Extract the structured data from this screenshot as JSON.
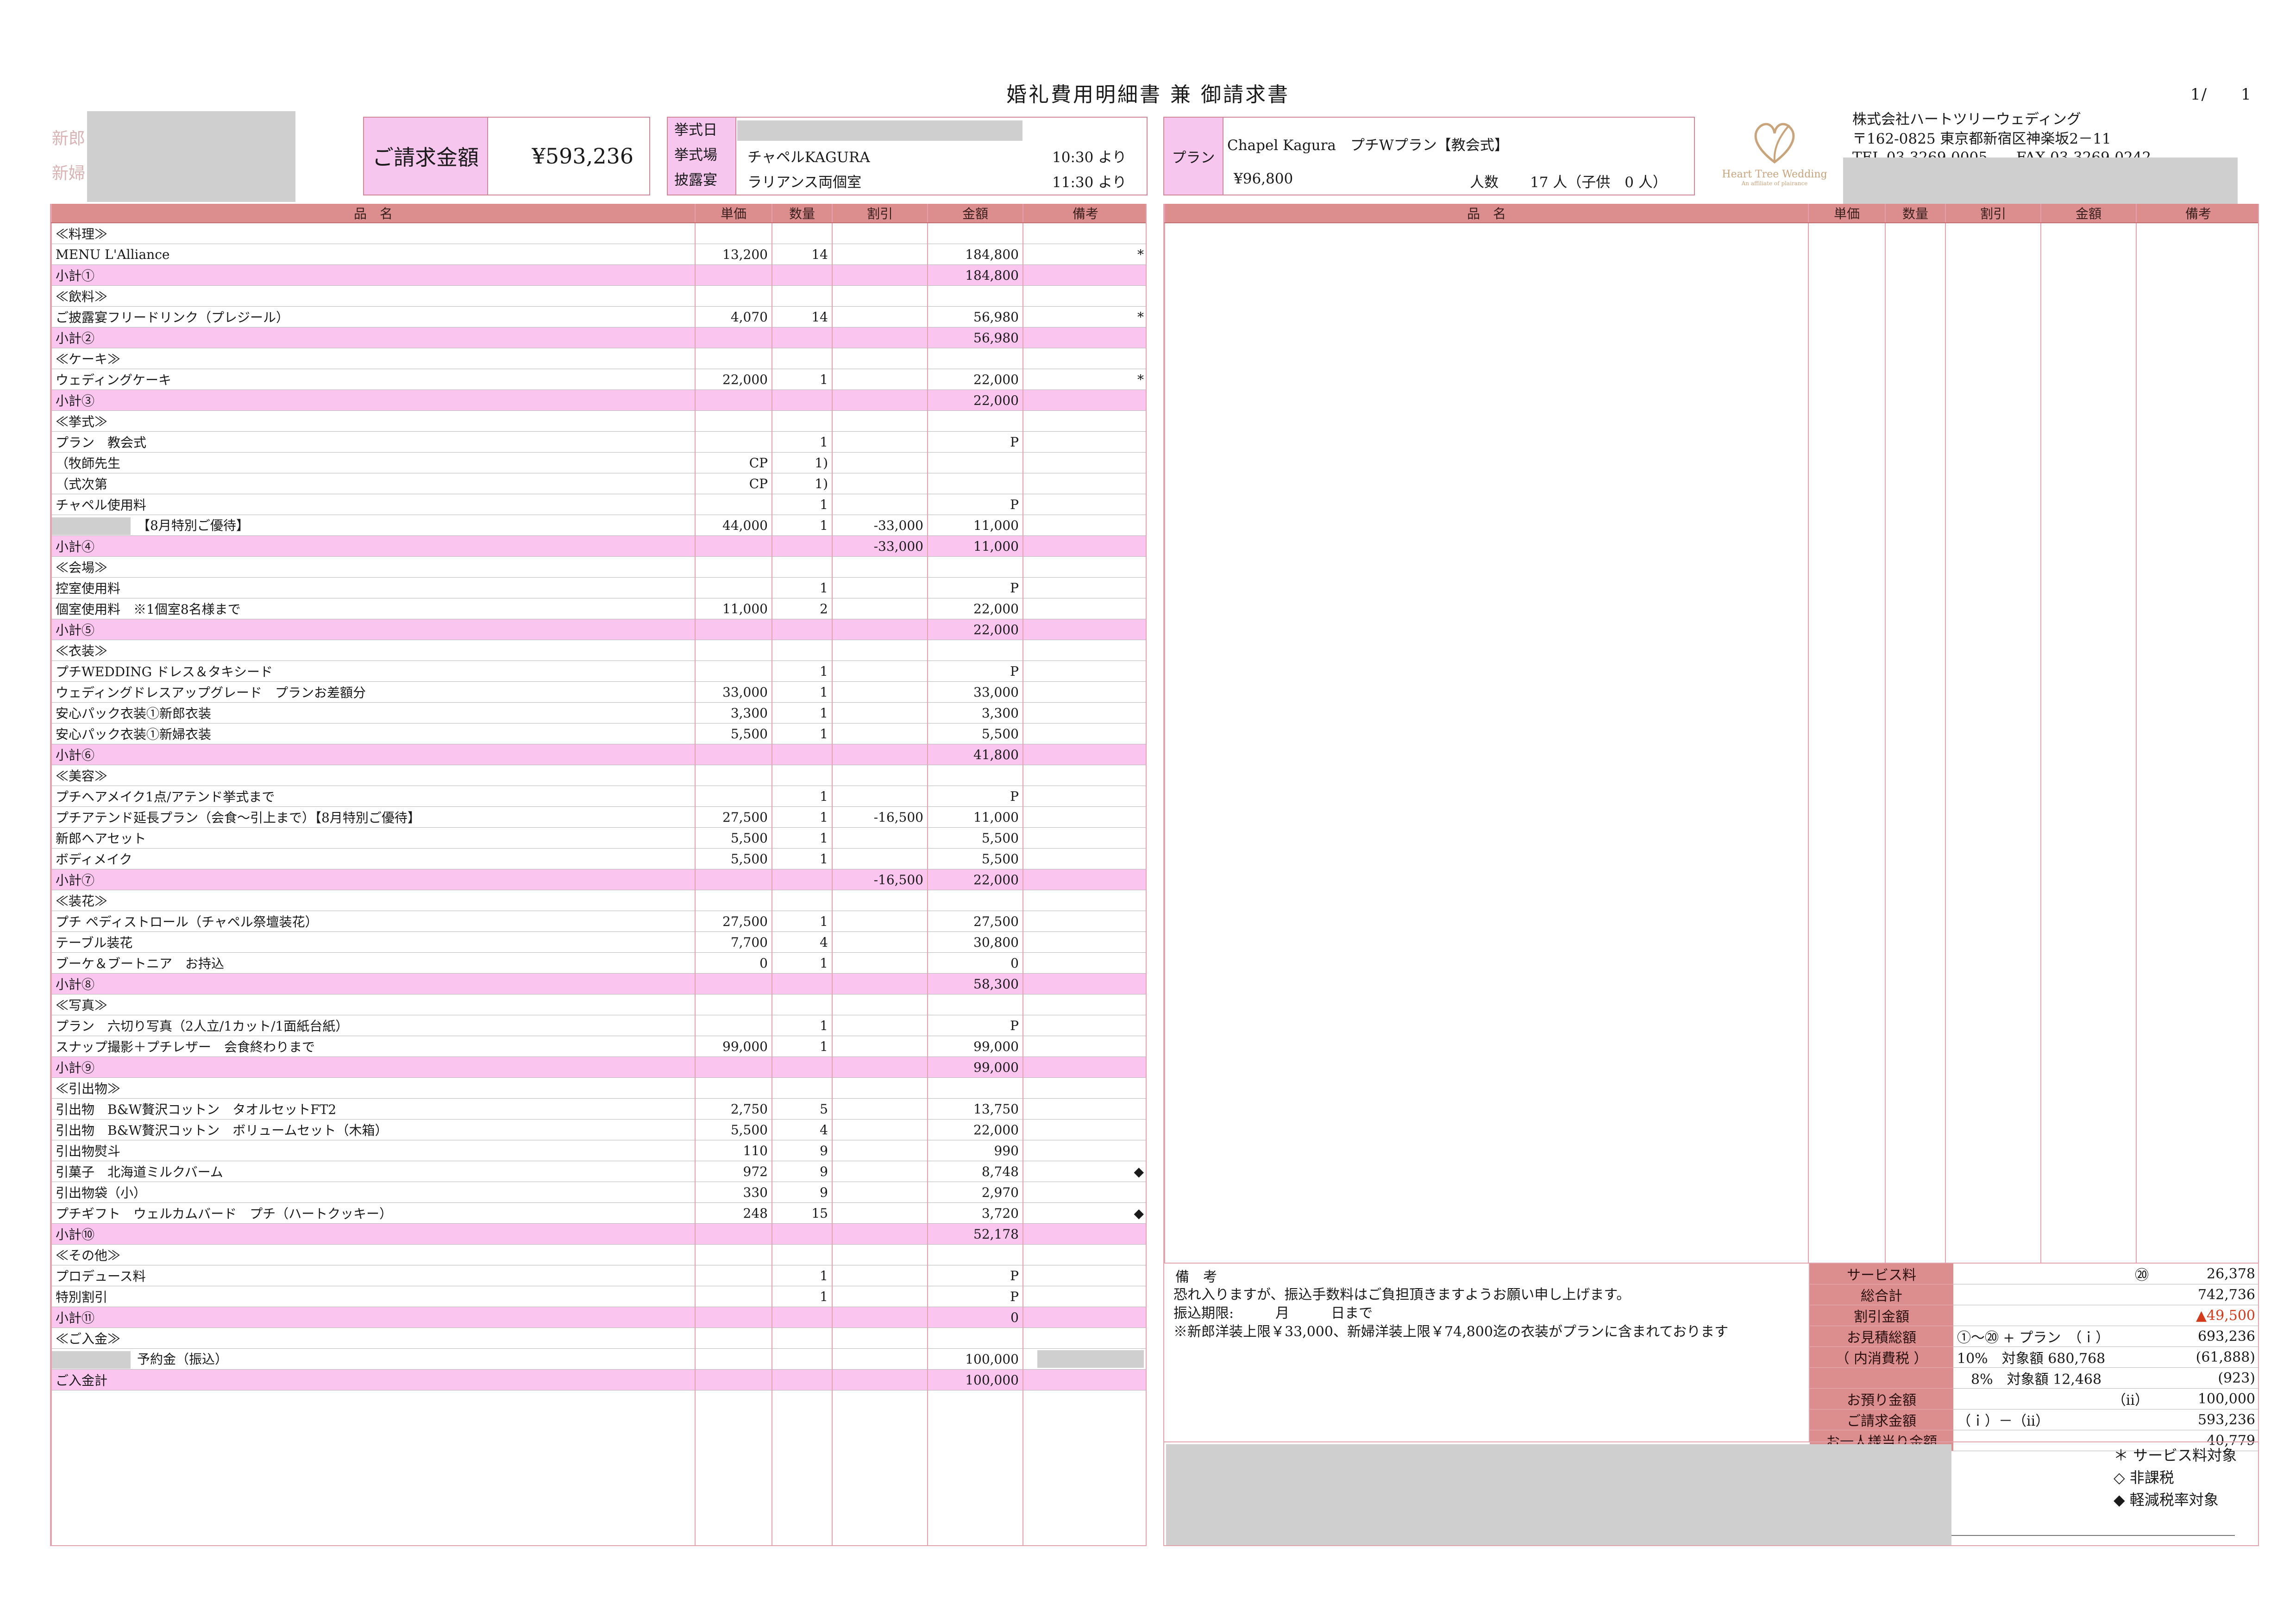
{
  "header": {
    "title": "婚礼費用明細書 兼 御請求書",
    "page": "1/　　1",
    "groom_label": "新郎",
    "bride_label": "新婦"
  },
  "invoice": {
    "label": "ご請求金額",
    "value": "¥593,236"
  },
  "ceremony": {
    "date_label": "挙式日",
    "venue_label": "挙式場",
    "venue": "チャペルKAGURA",
    "venue_time": "10:30 より",
    "reception_label": "披露宴",
    "reception": "ラリアンス両個室",
    "reception_time": "11:30 より"
  },
  "plan": {
    "label": "プラン",
    "name": "Chapel Kagura　プチWプラン【教会式】",
    "price": "¥96,800",
    "people_label": "人数",
    "people": "17 人（子供　0 人）"
  },
  "company": {
    "logo_text": "Heart Tree Wedding",
    "logo_sub": "An affiliate of plairance",
    "name": "株式会社ハートツリーウェディング",
    "address": "〒162-0825 東京都新宿区神楽坂2－11",
    "tel": "TEL 03-3269-0005　　FAX 03-3269-0242"
  },
  "table_headers": {
    "name": "品　名",
    "unit": "単価",
    "qty": "数量",
    "discount": "割引",
    "amount": "金額",
    "note": "備考"
  },
  "rows": [
    {
      "name": "≪料理≫",
      "unit": "",
      "qty": "",
      "disc": "",
      "amt": "",
      "note": "",
      "sub": false
    },
    {
      "name": "MENU L'Alliance",
      "unit": "13,200",
      "qty": "14",
      "disc": "",
      "amt": "184,800",
      "note": "*",
      "sub": false
    },
    {
      "name": "小計①",
      "unit": "",
      "qty": "",
      "disc": "",
      "amt": "184,800",
      "note": "",
      "sub": true
    },
    {
      "name": "≪飲料≫",
      "unit": "",
      "qty": "",
      "disc": "",
      "amt": "",
      "note": "",
      "sub": false
    },
    {
      "name": "ご披露宴フリードリンク（プレジール）",
      "unit": "4,070",
      "qty": "14",
      "disc": "",
      "amt": "56,980",
      "note": "*",
      "sub": false
    },
    {
      "name": "小計②",
      "unit": "",
      "qty": "",
      "disc": "",
      "amt": "56,980",
      "note": "",
      "sub": true
    },
    {
      "name": "≪ケーキ≫",
      "unit": "",
      "qty": "",
      "disc": "",
      "amt": "",
      "note": "",
      "sub": false
    },
    {
      "name": "ウェディングケーキ",
      "unit": "22,000",
      "qty": "1",
      "disc": "",
      "amt": "22,000",
      "note": "*",
      "sub": false
    },
    {
      "name": "小計③",
      "unit": "",
      "qty": "",
      "disc": "",
      "amt": "22,000",
      "note": "",
      "sub": true
    },
    {
      "name": "≪挙式≫",
      "unit": "",
      "qty": "",
      "disc": "",
      "amt": "",
      "note": "",
      "sub": false
    },
    {
      "name": "プラン　教会式",
      "unit": "",
      "qty": "1",
      "disc": "",
      "amt": "P",
      "note": "",
      "sub": false
    },
    {
      "name": "（牧師先生",
      "unit": "CP",
      "qty": "1)",
      "disc": "",
      "amt": "",
      "note": "",
      "sub": false
    },
    {
      "name": "（式次第",
      "unit": "CP",
      "qty": "1)",
      "disc": "",
      "amt": "",
      "note": "",
      "sub": false
    },
    {
      "name": "チャペル使用料",
      "unit": "",
      "qty": "1",
      "disc": "",
      "amt": "P",
      "note": "",
      "sub": false
    },
    {
      "name": "【8月特別ご優待】",
      "unit": "44,000",
      "qty": "1",
      "disc": "-33,000",
      "amt": "11,000",
      "note": "",
      "sub": false,
      "redacted": true
    },
    {
      "name": "小計④",
      "unit": "",
      "qty": "",
      "disc": "-33,000",
      "amt": "11,000",
      "note": "",
      "sub": true
    },
    {
      "name": "≪会場≫",
      "unit": "",
      "qty": "",
      "disc": "",
      "amt": "",
      "note": "",
      "sub": false
    },
    {
      "name": "控室使用料",
      "unit": "",
      "qty": "1",
      "disc": "",
      "amt": "P",
      "note": "",
      "sub": false
    },
    {
      "name": "個室使用料　※1個室8名様まで",
      "unit": "11,000",
      "qty": "2",
      "disc": "",
      "amt": "22,000",
      "note": "",
      "sub": false
    },
    {
      "name": "小計⑤",
      "unit": "",
      "qty": "",
      "disc": "",
      "amt": "22,000",
      "note": "",
      "sub": true
    },
    {
      "name": "≪衣装≫",
      "unit": "",
      "qty": "",
      "disc": "",
      "amt": "",
      "note": "",
      "sub": false
    },
    {
      "name": "プチWEDDING ドレス＆タキシード",
      "unit": "",
      "qty": "1",
      "disc": "",
      "amt": "P",
      "note": "",
      "sub": false
    },
    {
      "name": "ウェディングドレスアップグレード　プランお差額分",
      "unit": "33,000",
      "qty": "1",
      "disc": "",
      "amt": "33,000",
      "note": "",
      "sub": false
    },
    {
      "name": "安心パック衣装①新郎衣装",
      "unit": "3,300",
      "qty": "1",
      "disc": "",
      "amt": "3,300",
      "note": "",
      "sub": false
    },
    {
      "name": "安心パック衣装①新婦衣装",
      "unit": "5,500",
      "qty": "1",
      "disc": "",
      "amt": "5,500",
      "note": "",
      "sub": false
    },
    {
      "name": "小計⑥",
      "unit": "",
      "qty": "",
      "disc": "",
      "amt": "41,800",
      "note": "",
      "sub": true
    },
    {
      "name": "≪美容≫",
      "unit": "",
      "qty": "",
      "disc": "",
      "amt": "",
      "note": "",
      "sub": false
    },
    {
      "name": "プチヘアメイク1点/アテンド挙式まで",
      "unit": "",
      "qty": "1",
      "disc": "",
      "amt": "P",
      "note": "",
      "sub": false
    },
    {
      "name": "プチアテンド延長プラン（会食～引上まで）【8月特別ご優待】",
      "unit": "27,500",
      "qty": "1",
      "disc": "-16,500",
      "amt": "11,000",
      "note": "",
      "sub": false
    },
    {
      "name": "新郎ヘアセット",
      "unit": "5,500",
      "qty": "1",
      "disc": "",
      "amt": "5,500",
      "note": "",
      "sub": false
    },
    {
      "name": "ボディメイク",
      "unit": "5,500",
      "qty": "1",
      "disc": "",
      "amt": "5,500",
      "note": "",
      "sub": false
    },
    {
      "name": "小計⑦",
      "unit": "",
      "qty": "",
      "disc": "-16,500",
      "amt": "22,000",
      "note": "",
      "sub": true
    },
    {
      "name": "≪装花≫",
      "unit": "",
      "qty": "",
      "disc": "",
      "amt": "",
      "note": "",
      "sub": false
    },
    {
      "name": "プチ ペディストロール（チャペル祭壇装花）",
      "unit": "27,500",
      "qty": "1",
      "disc": "",
      "amt": "27,500",
      "note": "",
      "sub": false
    },
    {
      "name": "テーブル装花",
      "unit": "7,700",
      "qty": "4",
      "disc": "",
      "amt": "30,800",
      "note": "",
      "sub": false
    },
    {
      "name": "ブーケ＆ブートニア　お持込",
      "unit": "0",
      "qty": "1",
      "disc": "",
      "amt": "0",
      "note": "",
      "sub": false
    },
    {
      "name": "小計⑧",
      "unit": "",
      "qty": "",
      "disc": "",
      "amt": "58,300",
      "note": "",
      "sub": true
    },
    {
      "name": "≪写真≫",
      "unit": "",
      "qty": "",
      "disc": "",
      "amt": "",
      "note": "",
      "sub": false
    },
    {
      "name": "プラン　六切り写真（2人立/1カット/1面紙台紙）",
      "unit": "",
      "qty": "1",
      "disc": "",
      "amt": "P",
      "note": "",
      "sub": false
    },
    {
      "name": "スナップ撮影＋プチレザー　会食終わりまで",
      "unit": "99,000",
      "qty": "1",
      "disc": "",
      "amt": "99,000",
      "note": "",
      "sub": false
    },
    {
      "name": "小計⑨",
      "unit": "",
      "qty": "",
      "disc": "",
      "amt": "99,000",
      "note": "",
      "sub": true
    },
    {
      "name": "≪引出物≫",
      "unit": "",
      "qty": "",
      "disc": "",
      "amt": "",
      "note": "",
      "sub": false
    },
    {
      "name": "引出物　B&W贅沢コットン　タオルセットFT2",
      "unit": "2,750",
      "qty": "5",
      "disc": "",
      "amt": "13,750",
      "note": "",
      "sub": false
    },
    {
      "name": "引出物　B&W贅沢コットン　ボリュームセット（木箱）",
      "unit": "5,500",
      "qty": "4",
      "disc": "",
      "amt": "22,000",
      "note": "",
      "sub": false
    },
    {
      "name": "引出物熨斗",
      "unit": "110",
      "qty": "9",
      "disc": "",
      "amt": "990",
      "note": "",
      "sub": false
    },
    {
      "name": "引菓子　北海道ミルクバーム",
      "unit": "972",
      "qty": "9",
      "disc": "",
      "amt": "8,748",
      "note": "◆",
      "sub": false
    },
    {
      "name": "引出物袋（小）",
      "unit": "330",
      "qty": "9",
      "disc": "",
      "amt": "2,970",
      "note": "",
      "sub": false
    },
    {
      "name": "プチギフト　ウェルカムバード　プチ（ハートクッキー）",
      "unit": "248",
      "qty": "15",
      "disc": "",
      "amt": "3,720",
      "note": "◆",
      "sub": false
    },
    {
      "name": "小計⑩",
      "unit": "",
      "qty": "",
      "disc": "",
      "amt": "52,178",
      "note": "",
      "sub": true
    },
    {
      "name": "≪その他≫",
      "unit": "",
      "qty": "",
      "disc": "",
      "amt": "",
      "note": "",
      "sub": false
    },
    {
      "name": "プロデュース料",
      "unit": "",
      "qty": "1",
      "disc": "",
      "amt": "P",
      "note": "",
      "sub": false
    },
    {
      "name": "特別割引",
      "unit": "",
      "qty": "1",
      "disc": "",
      "amt": "P",
      "note": "",
      "sub": false
    },
    {
      "name": "小計⑪",
      "unit": "",
      "qty": "",
      "disc": "",
      "amt": "0",
      "note": "",
      "sub": true
    },
    {
      "name": "≪ご入金≫",
      "unit": "",
      "qty": "",
      "disc": "",
      "amt": "",
      "note": "",
      "sub": false
    },
    {
      "name": "予約金（振込）",
      "unit": "",
      "qty": "",
      "disc": "",
      "amt": "100,000",
      "note": "",
      "sub": false,
      "redacted": true,
      "note_redacted": true
    },
    {
      "name": "ご入金計",
      "unit": "",
      "qty": "",
      "disc": "",
      "amt": "100,000",
      "note": "",
      "sub": true
    }
  ],
  "remarks": {
    "title": "備　考",
    "lines": [
      "恐れ入りますが、振込手数料はご負担頂きますようお願い申し上げます。",
      "振込期限:　　　月　　　日まで",
      "※新郎洋装上限￥33,000、新婦洋装上限￥74,800迄の衣装がプランに含まれております"
    ]
  },
  "summary": [
    {
      "label": "サービス料",
      "mid": "⑳",
      "value": "26,378"
    },
    {
      "label": "総合計",
      "mid": "",
      "value": "742,736"
    },
    {
      "label": "割引金額",
      "mid": "",
      "value": "▲49,500",
      "red": true
    },
    {
      "label": "お見積総額",
      "mid": "①～⑳ + プラン　（ｉ）",
      "value": "693,236"
    },
    {
      "label": "（ 内消費税 ）",
      "mid": "10%　対象額 680,768",
      "value": "(61,888)"
    },
    {
      "label": "",
      "mid": "　8%　対象額 12,468",
      "value": "(923)"
    },
    {
      "label": "お預り金額",
      "mid": "（ⅱ）",
      "value": "100,000"
    },
    {
      "label": "ご請求金額",
      "mid": "（ｉ）－（ⅱ）",
      "value": "593,236"
    },
    {
      "label": "お一人様当り金額",
      "mid": "",
      "value": "40,779"
    }
  ],
  "legend": [
    "＊ サービス料対象",
    "◇ 非課税",
    "◆ 軽減税率対象"
  ],
  "colors": {
    "header_bg": "#dc8d8d",
    "subtotal_bg": "#fac5ee",
    "border": "#e3a2ae"
  }
}
